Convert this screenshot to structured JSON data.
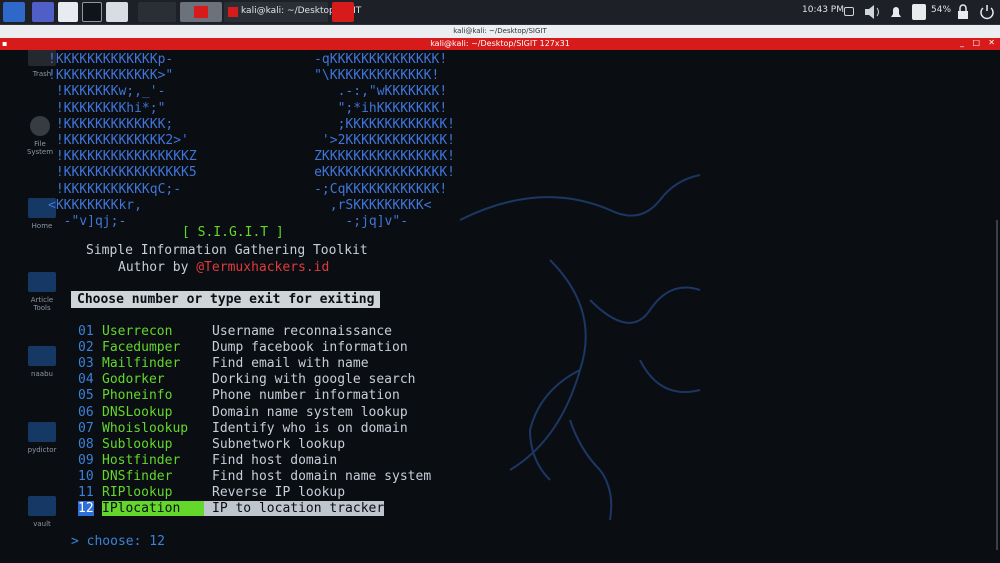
{
  "taskbar": {
    "window_label": "kali@kali: ~/Desktop/SIGIT",
    "clock": "10:43 PM",
    "battery": "54%"
  },
  "window": {
    "tab_title": "kali@kali: ~/Desktop/SIGIT",
    "title": "kali@kali: ~/Desktop/SIGIT 127x31"
  },
  "desktop_icons": [
    "Trash",
    "File System",
    "Home",
    "Article Tools",
    "naabu",
    "pydictor",
    "vault"
  ],
  "banner": {
    "art": [
      "!KKKKKKKKKKKKKp-                  -qKKKKKKKKKKKKKK!",
      "!KKKKKKKKKKKKK>\"                  \"\\KKKKKKKKKKKKK!",
      " !KKKKKKKw;,_'-                      .-:,\"wKKKKKKK!",
      " !KKKKKKKKhi*;\"                      \";*ihKKKKKKKK!",
      " !KKKKKKKKKKKKK;                     ;KKKKKKKKKKKKK!",
      " !KKKKKKKKKKKKK2>'                 '>2KKKKKKKKKKKKK!",
      " !KKKKKKKKKKKKKKKKZ               ZKKKKKKKKKKKKKKKK!",
      " !KKKKKKKKKKKKKKKK5               eKKKKKKKKKKKKKKKK!",
      " !KKKKKKKKKKKqC;-                 -;CqKKKKKKKKKKKK!",
      "<KKKKKKKKkr,                        ,rSKKKKKKKKK<",
      "  -\"v]qj;-                            -;jq]v\"-"
    ],
    "name": "[ S.I.G.I.T ]",
    "subtitle": "Simple Information Gathering Toolkit",
    "author_label": "Author by",
    "author_handle": "@Termuxhackers.id"
  },
  "prompt_header": "Choose number or type exit for exiting",
  "menu": [
    {
      "num": "01",
      "name": "Userrecon",
      "desc": "Username reconnaissance"
    },
    {
      "num": "02",
      "name": "Facedumper",
      "desc": "Dump facebook information"
    },
    {
      "num": "03",
      "name": "Mailfinder",
      "desc": "Find email with name"
    },
    {
      "num": "04",
      "name": "Godorker",
      "desc": "Dorking with google search"
    },
    {
      "num": "05",
      "name": "Phoneinfo",
      "desc": "Phone number information"
    },
    {
      "num": "06",
      "name": "DNSLookup",
      "desc": "Domain name system lookup"
    },
    {
      "num": "07",
      "name": "Whoislookup",
      "desc": "Identify who is on domain"
    },
    {
      "num": "08",
      "name": "Sublookup",
      "desc": "Subnetwork lookup"
    },
    {
      "num": "09",
      "name": "Hostfinder",
      "desc": "Find host domain"
    },
    {
      "num": "10",
      "name": "DNSfinder",
      "desc": "Find host domain name system"
    },
    {
      "num": "11",
      "name": "RIPlookup",
      "desc": "Reverse IP lookup"
    },
    {
      "num": "12",
      "name": "IPlocation",
      "desc": "IP to location tracker"
    }
  ],
  "selected_index": 11,
  "input": {
    "prompt": "> choose:",
    "value": "12"
  }
}
